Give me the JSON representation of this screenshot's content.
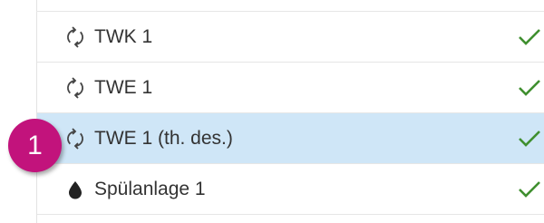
{
  "list": {
    "items": [
      {
        "icon": "sync-icon",
        "label": "TWK 1",
        "status": "check-icon",
        "selected": false
      },
      {
        "icon": "sync-icon",
        "label": "TWE 1",
        "status": "check-icon",
        "selected": false
      },
      {
        "icon": "sync-icon",
        "label": "TWE 1 (th. des.)",
        "status": "check-icon",
        "selected": true
      },
      {
        "icon": "water-drop-icon",
        "label": "Spülanlage 1",
        "status": "check-icon",
        "selected": false
      }
    ]
  },
  "callout": {
    "number": "1",
    "color": "#c2137c"
  },
  "colors": {
    "selected_row": "#cfe6f7",
    "check": "#3f8f2f",
    "icon": "#444444"
  }
}
